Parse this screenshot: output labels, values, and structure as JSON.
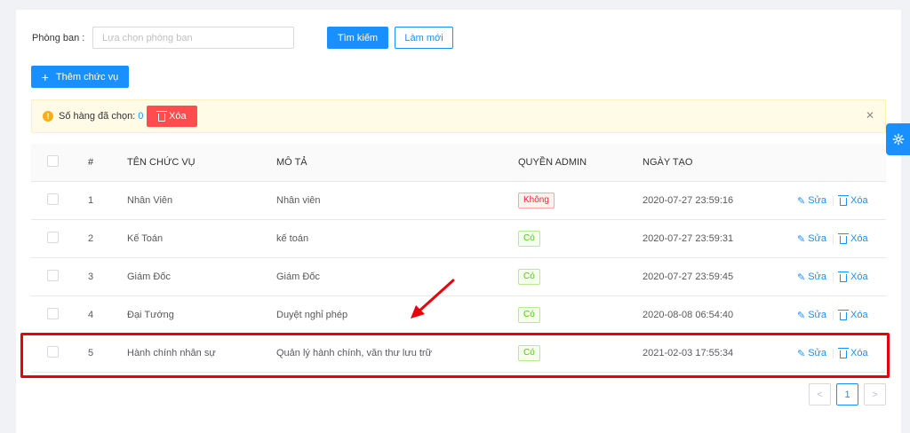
{
  "filter": {
    "department_label": "Phòng ban",
    "department_colon": ":",
    "department_placeholder": "Lựa chọn phòng ban",
    "search_label": "Tìm kiếm",
    "refresh_label": "Làm mới"
  },
  "toolbar": {
    "add_label": "Thêm chức vụ"
  },
  "alert": {
    "selected_text": "Số hàng đã chọn:",
    "selected_count": "0",
    "delete_label": "Xóa",
    "close_icon": "close-icon"
  },
  "table": {
    "columns": [
      "#",
      "TÊN CHỨC VỤ",
      "MÔ TẢ",
      "QUYỀN ADMIN",
      "NGÀY TẠO"
    ],
    "rows": [
      {
        "index": "1",
        "name": "Nhân Viên",
        "description": "Nhân viên",
        "admin": "Không",
        "admin_status": "no",
        "created": "2020-07-27 23:59:16"
      },
      {
        "index": "2",
        "name": "Kế Toán",
        "description": "kế toán",
        "admin": "Có",
        "admin_status": "yes",
        "created": "2020-07-27 23:59:31"
      },
      {
        "index": "3",
        "name": "Giám Đốc",
        "description": "Giám Đốc",
        "admin": "Có",
        "admin_status": "yes",
        "created": "2020-07-27 23:59:45"
      },
      {
        "index": "4",
        "name": "Đại Tướng",
        "description": "Duyệt nghỉ phép",
        "admin": "Có",
        "admin_status": "yes",
        "created": "2020-08-08 06:54:40"
      },
      {
        "index": "5",
        "name": "Hành chính nhân sự",
        "description": "Quản lý hành chính, văn thư lưu trữ",
        "admin": "Có",
        "admin_status": "yes",
        "created": "2021-02-03 17:55:34"
      }
    ],
    "edit_label": "Sửa",
    "delete_label": "Xóa"
  },
  "pagination": {
    "prev": "<",
    "current": "1",
    "next": ">"
  },
  "colors": {
    "primary": "#1890ff",
    "danger": "#ff4d4f",
    "highlight": "#e8000b"
  }
}
